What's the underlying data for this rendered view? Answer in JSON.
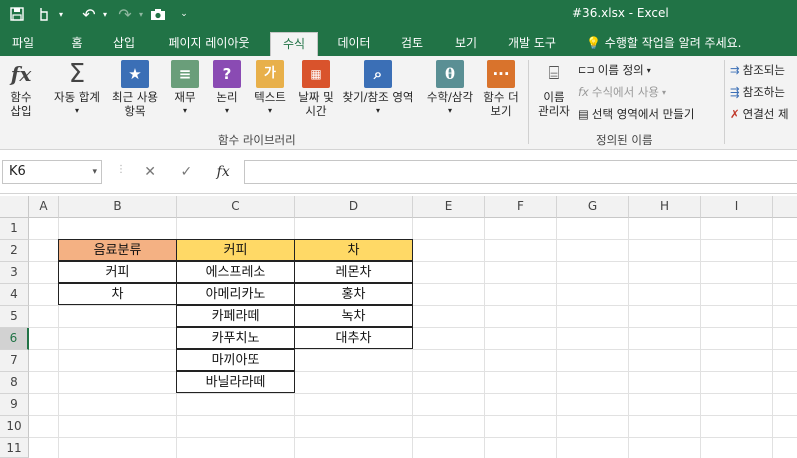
{
  "window": {
    "title": "#36.xlsx - Excel"
  },
  "tabs": [
    {
      "label": "파일"
    },
    {
      "label": "홈"
    },
    {
      "label": "삽입"
    },
    {
      "label": "페이지 레이아웃"
    },
    {
      "label": "수식"
    },
    {
      "label": "데이터"
    },
    {
      "label": "검토"
    },
    {
      "label": "보기"
    },
    {
      "label": "개발 도구"
    }
  ],
  "tell_me": "수행할 작업을 알려 주세요.",
  "ribbon": {
    "insert_function": "함수\n삽입",
    "autosum": "자동 합계",
    "recent": "최근 사용\n항목",
    "financial": "재무",
    "logical": "논리",
    "text": "텍스트",
    "datetime": "날짜 및\n시간",
    "lookup": "찾기/참조 영역",
    "math": "수학/삼각",
    "more": "함수 더\n보기",
    "library_group": "함수 라이브러리",
    "name_manager": "이름\n관리자",
    "define_name": "이름 정의",
    "use_in_formula": "수식에서 사용",
    "create_from_selection": "선택 영역에서 만들기",
    "defined_names_group": "정의된 이름",
    "trace_precedents": "참조되는",
    "trace_dependents": "참조하는",
    "remove_arrows": "연결선 제"
  },
  "formula_bar": {
    "name_box": "K6",
    "cancel": "✕",
    "enter": "✓",
    "fx": "fx",
    "value": ""
  },
  "grid": {
    "columns": [
      "A",
      "B",
      "C",
      "D",
      "E",
      "F",
      "G",
      "H",
      "I"
    ],
    "rows": [
      "1",
      "2",
      "3",
      "4",
      "5",
      "6",
      "7",
      "8",
      "9",
      "10",
      "11"
    ],
    "selected_row": "6",
    "cells": {
      "B2": "음료분류",
      "C2": "커피",
      "D2": "차",
      "B3": "커피",
      "B4": "차",
      "C3": "에스프레소",
      "C4": "아메리카노",
      "C5": "카페라떼",
      "C6": "카푸치노",
      "C7": "마끼아또",
      "C8": "바닐라라떼",
      "D3": "레몬차",
      "D4": "홍차",
      "D5": "녹차",
      "D6": "대추차"
    }
  },
  "colors": {
    "brand": "#217346",
    "header_orange": "#f4b183",
    "header_yellow": "#ffd966"
  }
}
